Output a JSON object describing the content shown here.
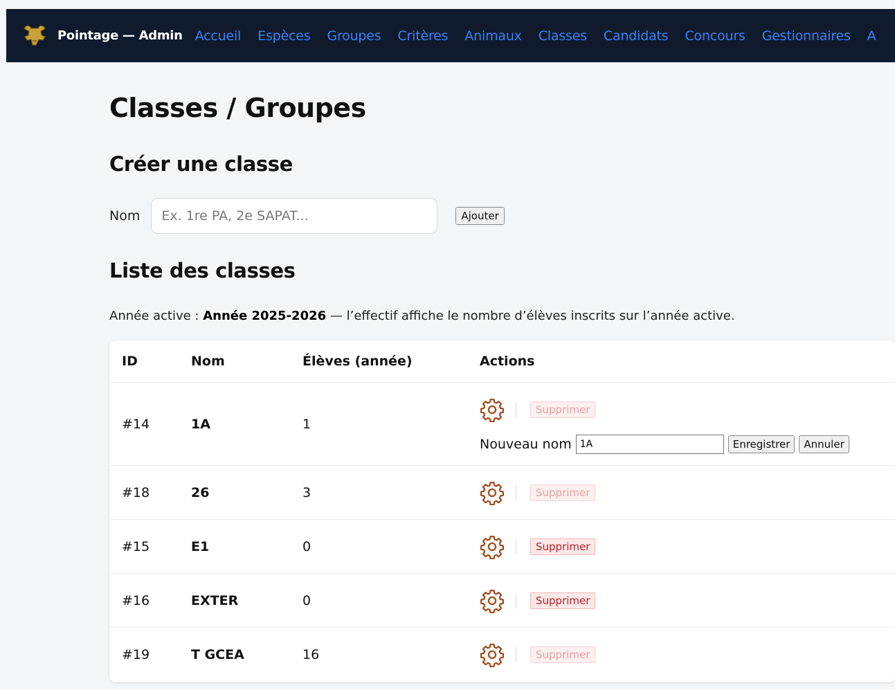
{
  "header": {
    "brand": "Pointage — Admin",
    "nav": [
      "Accueil",
      "Espèces",
      "Groupes",
      "Critères",
      "Animaux",
      "Classes",
      "Candidats",
      "Concours",
      "Gestionnaires",
      "A"
    ]
  },
  "page_title": "Classes / Groupes",
  "create": {
    "title": "Créer une classe",
    "label": "Nom",
    "placeholder": "Ex. 1re PA, 2e SAPAT...",
    "add_label": "Ajouter"
  },
  "list": {
    "title": "Liste des classes",
    "active_prefix": "Année active : ",
    "active_year": "Année 2025-2026",
    "active_suffix": " — l’effectif affiche le nombre d’élèves inscrits sur l’année active.",
    "columns": [
      "ID",
      "Nom",
      "Élèves (année)",
      "Actions"
    ],
    "delete_label": "Supprimer",
    "rows": [
      {
        "id": "#14",
        "nom": "1A",
        "eleves": "1",
        "delete_enabled": false
      },
      {
        "id": "#18",
        "nom": "26",
        "eleves": "3",
        "delete_enabled": false
      },
      {
        "id": "#15",
        "nom": "E1",
        "eleves": "0",
        "delete_enabled": true
      },
      {
        "id": "#16",
        "nom": "EXTER",
        "eleves": "0",
        "delete_enabled": true
      },
      {
        "id": "#19",
        "nom": "T GCEA",
        "eleves": "16",
        "delete_enabled": false
      }
    ],
    "rename": {
      "label": "Nouveau nom",
      "value": "1A",
      "save_label": "Enregistrer",
      "cancel_label": "Annuler"
    }
  },
  "colors": {
    "topbar": "#0f1b2d",
    "nav_link": "#3b82f6",
    "gear": "#a34a1b",
    "delete_text": "#b4232a"
  }
}
